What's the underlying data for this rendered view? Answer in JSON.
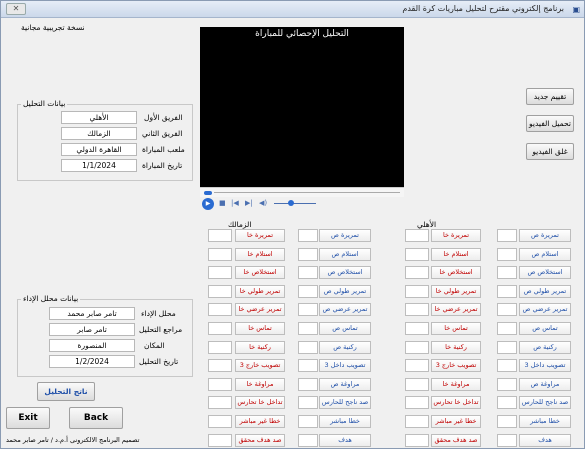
{
  "window": {
    "title": "برنامج إلكتروني مقترح لتحليل مباريات كرة القدم",
    "close_glyph": "✕"
  },
  "trial": {
    "label": "نسخة تجريبية مجانية"
  },
  "video": {
    "overlay_title": "التحليل الإحصائي للمباراة"
  },
  "right_buttons": {
    "new_eval": "تقييم جديد",
    "load_video": "تحميل الفيديو",
    "close_video": "غلق الفيديو"
  },
  "analysis_data": {
    "group_title": "بيانات التحليل",
    "fields": [
      {
        "label": "الفريق الأول",
        "value": "الأهلي"
      },
      {
        "label": "الفريق الثاني",
        "value": "الزمالك"
      },
      {
        "label": "ملعب المباراة",
        "value": "القاهرة الدولي"
      },
      {
        "label": "تاريخ المباراة",
        "value": "1/1/2024"
      }
    ]
  },
  "entry_data": {
    "group_title": "بيانات محلل الإداء",
    "fields": [
      {
        "label": "محلل الإداء",
        "value": "تامر صابر محمد"
      },
      {
        "label": "مراجع التحليل",
        "value": "تامر صابر"
      },
      {
        "label": "المكان",
        "value": "المنصورة"
      },
      {
        "label": "تاريخ التحليل",
        "value": "1/2/2024"
      }
    ]
  },
  "analysis_result_button": "ناتج التحليل",
  "exit_button": "Exit",
  "back_button": "Back",
  "footer": "تصميم البرنامج الالكترونى أ.م.د / تامر صابر محمد",
  "teams": {
    "left": "الزمالك",
    "right": "الأهلي"
  },
  "stats": [
    {
      "own": "تمريرة خا",
      "against": "تمريرة ص"
    },
    {
      "own": "استلام خا",
      "against": "استلام ص"
    },
    {
      "own": "استخلاص خا",
      "against": "استخلاص ص"
    },
    {
      "own": "تمرير طولي خا",
      "against": "تمرير طولي ص"
    },
    {
      "own": "تمرير عرضي خا",
      "against": "تمرير عرضي ص"
    },
    {
      "own": "تماس خا",
      "against": "تماس ص"
    },
    {
      "own": "ركنية خا",
      "against": "ركنية ص"
    },
    {
      "own": "تصويب خارج 3",
      "against": "تصويب داخل 3"
    },
    {
      "own": "مراوغة خا",
      "against": "مراوغة ص"
    },
    {
      "own": "تداخل خا تحارس",
      "against": "صد ناجح للحارس"
    },
    {
      "own": "خطا غير مباشر",
      "against": "خطا مباشر"
    },
    {
      "own": "صد هدف محقق",
      "against": "هدف"
    }
  ],
  "media": {
    "rewind": "◀◀",
    "stop": "■",
    "prev": "|◀",
    "next": "▶|",
    "volume": "🔊",
    "play": "▶"
  }
}
